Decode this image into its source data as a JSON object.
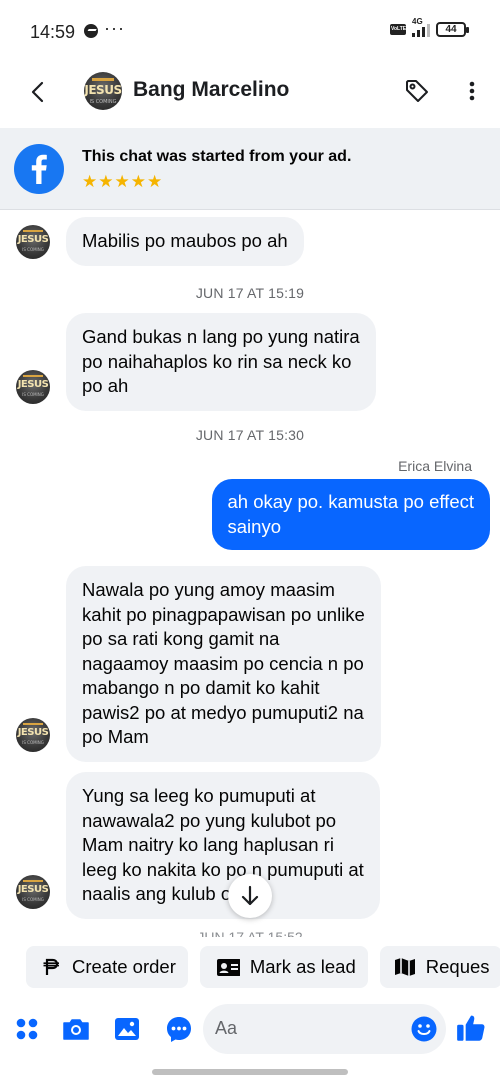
{
  "status_bar": {
    "time": "14:59",
    "dots": "···",
    "volte": "VoLTE",
    "network": "4G",
    "battery": "44"
  },
  "header": {
    "contact_name": "Bang Marcelino",
    "avatar_text": "JESUS",
    "avatar_subtext": "IS COMING"
  },
  "ad_banner": {
    "text": "This chat was started from your ad.",
    "stars": "★★★★★",
    "rating": 5
  },
  "messages": [
    {
      "direction": "in",
      "text": "Mabilis po maubos po ah"
    },
    {
      "type": "timestamp",
      "text": "JUN 17 AT 15:19"
    },
    {
      "direction": "in",
      "text": "Gand bukas n lang po yung natira\npo naihahaplos ko rin sa neck ko\npo ah"
    },
    {
      "type": "timestamp",
      "text": "JUN 17 AT 15:30"
    },
    {
      "sender": "Erica Elvina"
    },
    {
      "direction": "out",
      "text": "ah okay po. kamusta po effect\nsainyo"
    },
    {
      "direction": "in",
      "text": "Nawala po yung amoy maasim\nkahit po pinagpapawisan po unlike\npo sa rati kong gamit na\nnagaamoy maasim po cencia n po\nmabango n po damit ko kahit\npawis2 po at medyo pumuputi2 na\npo Mam"
    },
    {
      "direction": "in",
      "text": "Yung sa leeg ko pumuputi at\nnawawala2 po yung kulubot po\nMam naitry ko lang haplusan ri\nleeg ko nakita ko po n pumuputi at\nnaalis ang kulub        o"
    },
    {
      "type": "timestamp",
      "text": "JUN 17 AT 15:52"
    }
  ],
  "actions": [
    {
      "label": "Create order",
      "icon": "peso-icon"
    },
    {
      "label": "Mark as lead",
      "icon": "id-card-icon"
    },
    {
      "label": "Reques",
      "icon": "map-icon"
    }
  ],
  "composer": {
    "placeholder": "Aa"
  },
  "colors": {
    "accent": "#0866ff",
    "facebook_blue": "#1877f2",
    "bubble_incoming": "#f0f2f5",
    "star": "#f5b400"
  }
}
